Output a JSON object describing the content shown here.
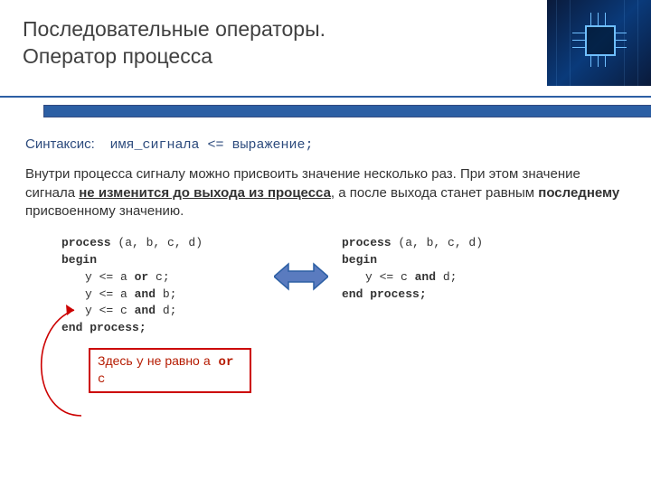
{
  "title_line1": "Последовательные операторы.",
  "title_line2": "Оператор процесса",
  "syntax_label": "Синтаксис:",
  "syntax_code": "имя_сигнала <= выражение;",
  "paragraph_pre": "Внутри процесса сигналу можно присвоить значение несколько раз. При этом значение сигнала ",
  "paragraph_bold_u": "не изменится до выхода из процесса",
  "paragraph_mid": ", а после выхода станет равным ",
  "paragraph_bold": "последнему",
  "paragraph_post": " присвоенному значению.",
  "code_left": {
    "l1_kw": "process",
    "l1_rest": " (a, b, c, d)",
    "l2": "begin",
    "l3_pre": "y <= a ",
    "l3_kw": "or",
    "l3_post": " c;",
    "l4_pre": "y <= a ",
    "l4_kw": "and",
    "l4_post": " b;",
    "l5_pre": "y <= c ",
    "l5_kw": "and",
    "l5_post": " d;",
    "l6": "end process;"
  },
  "code_right": {
    "l1_kw": "process",
    "l1_rest": " (a, b, c, d)",
    "l2": "begin",
    "l3_pre": "y <= c ",
    "l3_kw": "and",
    "l3_post": " d;",
    "l4": "end process;"
  },
  "callout": {
    "pre": "Здесь ",
    "y": "y",
    "mid": " не равно ",
    "a": "a ",
    "or": "or",
    "c": " c"
  },
  "colors": {
    "accent": "#2c5fa4",
    "callout": "#cc0000"
  }
}
